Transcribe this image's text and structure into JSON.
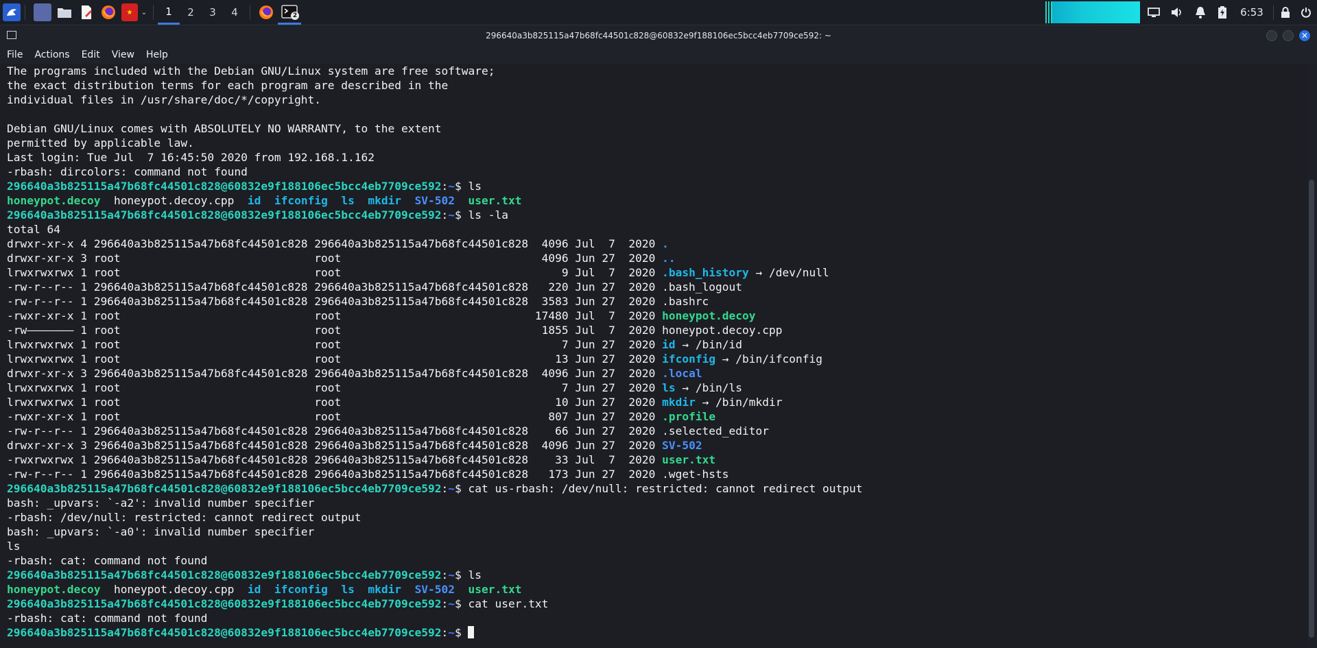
{
  "taskbar": {
    "workspaces": [
      "1",
      "2",
      "3",
      "4"
    ],
    "active_workspace": "1",
    "terminal_badge": "2",
    "clock": "6:53"
  },
  "window": {
    "title": "296640a3b825115a47b68fc44501c828@60832e9f188106ec5bcc4eb7709ce592: ~",
    "close_glyph": "✕"
  },
  "menu": [
    "File",
    "Actions",
    "Edit",
    "View",
    "Help"
  ],
  "terminal": {
    "prompt_user": "296640a3b825115a47b68fc44501c828@60832e9f188106ec5bcc4eb7709ce592",
    "prompt_path": "~",
    "prompt_suffix": "$",
    "lines": [
      {
        "segs": [
          {
            "t": "The programs included with the Debian GNU/Linux system are free software;",
            "c": "plain"
          }
        ]
      },
      {
        "segs": [
          {
            "t": "the exact distribution terms for each program are described in the",
            "c": "plain"
          }
        ]
      },
      {
        "segs": [
          {
            "t": "individual files in /usr/share/doc/*/copyright.",
            "c": "plain"
          }
        ]
      },
      {
        "segs": [
          {
            "t": "",
            "c": "plain"
          }
        ]
      },
      {
        "segs": [
          {
            "t": "Debian GNU/Linux comes with ABSOLUTELY NO WARRANTY, to the extent",
            "c": "plain"
          }
        ]
      },
      {
        "segs": [
          {
            "t": "permitted by applicable law.",
            "c": "plain"
          }
        ]
      },
      {
        "segs": [
          {
            "t": "Last login: Tue Jul  7 16:45:50 2020 from 192.168.1.162",
            "c": "plain"
          }
        ]
      },
      {
        "segs": [
          {
            "t": "-rbash: dircolors: command not found",
            "c": "plain"
          }
        ]
      },
      {
        "prompt": true,
        "segs": [
          {
            "t": " ls",
            "c": "plain"
          }
        ]
      },
      {
        "segs": [
          {
            "t": "honeypot.decoy",
            "c": "exec"
          },
          {
            "t": "  honeypot.decoy.cpp  ",
            "c": "plain"
          },
          {
            "t": "id",
            "c": "linkc"
          },
          {
            "t": "  ",
            "c": "plain"
          },
          {
            "t": "ifconfig",
            "c": "linkc"
          },
          {
            "t": "  ",
            "c": "plain"
          },
          {
            "t": "ls",
            "c": "linkc"
          },
          {
            "t": "  ",
            "c": "plain"
          },
          {
            "t": "mkdir",
            "c": "linkc"
          },
          {
            "t": "  ",
            "c": "plain"
          },
          {
            "t": "SV-502",
            "c": "dirc"
          },
          {
            "t": "  ",
            "c": "plain"
          },
          {
            "t": "user.txt",
            "c": "exec"
          }
        ]
      },
      {
        "prompt": true,
        "segs": [
          {
            "t": " ls -la",
            "c": "plain"
          }
        ]
      },
      {
        "segs": [
          {
            "t": "total 64",
            "c": "plain"
          }
        ]
      },
      {
        "segs": [
          {
            "t": "drwxr-xr-x 4 296640a3b825115a47b68fc44501c828 296640a3b825115a47b68fc44501c828  4096 Jul  7  2020 ",
            "c": "plain"
          },
          {
            "t": ".",
            "c": "dirc"
          }
        ]
      },
      {
        "segs": [
          {
            "t": "drwxr-xr-x 3 root                             root                              4096 Jun 27  2020 ",
            "c": "plain"
          },
          {
            "t": "..",
            "c": "dirc"
          }
        ]
      },
      {
        "segs": [
          {
            "t": "lrwxrwxrwx 1 root                             root                                 9 Jul  7  2020 ",
            "c": "plain"
          },
          {
            "t": ".bash_history",
            "c": "linkc"
          },
          {
            "t": " → /dev/null",
            "c": "plain"
          }
        ]
      },
      {
        "segs": [
          {
            "t": "-rw-r--r-- 1 296640a3b825115a47b68fc44501c828 296640a3b825115a47b68fc44501c828   220 Jun 27  2020 .bash_logout",
            "c": "plain"
          }
        ]
      },
      {
        "segs": [
          {
            "t": "-rw-r--r-- 1 296640a3b825115a47b68fc44501c828 296640a3b825115a47b68fc44501c828  3583 Jun 27  2020 .bashrc",
            "c": "plain"
          }
        ]
      },
      {
        "segs": [
          {
            "t": "-rwxr-xr-x 1 root                             root                             17480 Jul  7  2020 ",
            "c": "plain"
          },
          {
            "t": "honeypot.decoy",
            "c": "exec"
          }
        ]
      },
      {
        "segs": [
          {
            "t": "-rw——————— 1 root                             root                              1855 Jul  7  2020 honeypot.decoy.cpp",
            "c": "plain"
          }
        ]
      },
      {
        "segs": [
          {
            "t": "lrwxrwxrwx 1 root                             root                                 7 Jun 27  2020 ",
            "c": "plain"
          },
          {
            "t": "id",
            "c": "linkc"
          },
          {
            "t": " → /bin/id",
            "c": "plain"
          }
        ]
      },
      {
        "segs": [
          {
            "t": "lrwxrwxrwx 1 root                             root                                13 Jun 27  2020 ",
            "c": "plain"
          },
          {
            "t": "ifconfig",
            "c": "linkc"
          },
          {
            "t": " → /bin/ifconfig",
            "c": "plain"
          }
        ]
      },
      {
        "segs": [
          {
            "t": "drwxr-xr-x 3 296640a3b825115a47b68fc44501c828 296640a3b825115a47b68fc44501c828  4096 Jun 27  2020 ",
            "c": "plain"
          },
          {
            "t": ".local",
            "c": "dirc"
          }
        ]
      },
      {
        "segs": [
          {
            "t": "lrwxrwxrwx 1 root                             root                                 7 Jun 27  2020 ",
            "c": "plain"
          },
          {
            "t": "ls",
            "c": "linkc"
          },
          {
            "t": " → /bin/ls",
            "c": "plain"
          }
        ]
      },
      {
        "segs": [
          {
            "t": "lrwxrwxrwx 1 root                             root                                10 Jun 27  2020 ",
            "c": "plain"
          },
          {
            "t": "mkdir",
            "c": "linkc"
          },
          {
            "t": " → /bin/mkdir",
            "c": "plain"
          }
        ]
      },
      {
        "segs": [
          {
            "t": "-rwxr-xr-x 1 root                             root                               807 Jun 27  2020 ",
            "c": "plain"
          },
          {
            "t": ".profile",
            "c": "exec"
          }
        ]
      },
      {
        "segs": [
          {
            "t": "-rw-r--r-- 1 296640a3b825115a47b68fc44501c828 296640a3b825115a47b68fc44501c828    66 Jun 27  2020 .selected_editor",
            "c": "plain"
          }
        ]
      },
      {
        "segs": [
          {
            "t": "drwxr-xr-x 3 296640a3b825115a47b68fc44501c828 296640a3b825115a47b68fc44501c828  4096 Jun 27  2020 ",
            "c": "plain"
          },
          {
            "t": "SV-502",
            "c": "dirc"
          }
        ]
      },
      {
        "segs": [
          {
            "t": "-rwxrwxrwx 1 296640a3b825115a47b68fc44501c828 296640a3b825115a47b68fc44501c828    33 Jul  7  2020 ",
            "c": "plain"
          },
          {
            "t": "user.txt",
            "c": "exec"
          }
        ]
      },
      {
        "segs": [
          {
            "t": "-rw-r--r-- 1 296640a3b825115a47b68fc44501c828 296640a3b825115a47b68fc44501c828   173 Jun 27  2020 .wget-hsts",
            "c": "plain"
          }
        ]
      },
      {
        "prompt": true,
        "segs": [
          {
            "t": " cat us-rbash: /dev/null: restricted: cannot redirect output",
            "c": "plain"
          }
        ]
      },
      {
        "segs": [
          {
            "t": "bash: _upvars: `-a2': invalid number specifier",
            "c": "plain"
          }
        ]
      },
      {
        "segs": [
          {
            "t": "-rbash: /dev/null: restricted: cannot redirect output",
            "c": "plain"
          }
        ]
      },
      {
        "segs": [
          {
            "t": "bash: _upvars: `-a0': invalid number specifier",
            "c": "plain"
          }
        ]
      },
      {
        "segs": [
          {
            "t": "ls",
            "c": "plain"
          }
        ]
      },
      {
        "segs": [
          {
            "t": "-rbash: cat: command not found",
            "c": "plain"
          }
        ]
      },
      {
        "prompt": true,
        "segs": [
          {
            "t": " ls",
            "c": "plain"
          }
        ]
      },
      {
        "segs": [
          {
            "t": "honeypot.decoy",
            "c": "exec"
          },
          {
            "t": "  honeypot.decoy.cpp  ",
            "c": "plain"
          },
          {
            "t": "id",
            "c": "linkc"
          },
          {
            "t": "  ",
            "c": "plain"
          },
          {
            "t": "ifconfig",
            "c": "linkc"
          },
          {
            "t": "  ",
            "c": "plain"
          },
          {
            "t": "ls",
            "c": "linkc"
          },
          {
            "t": "  ",
            "c": "plain"
          },
          {
            "t": "mkdir",
            "c": "linkc"
          },
          {
            "t": "  ",
            "c": "plain"
          },
          {
            "t": "SV-502",
            "c": "dirc"
          },
          {
            "t": "  ",
            "c": "plain"
          },
          {
            "t": "user.txt",
            "c": "exec"
          }
        ]
      },
      {
        "prompt": true,
        "segs": [
          {
            "t": " cat user.txt",
            "c": "plain"
          }
        ]
      },
      {
        "segs": [
          {
            "t": "-rbash: cat: command not found",
            "c": "plain"
          }
        ]
      },
      {
        "prompt": true,
        "cursor": true,
        "segs": [
          {
            "t": " ",
            "c": "plain"
          }
        ]
      }
    ]
  },
  "colors": {
    "prompt": "#2bd6c0",
    "directory": "#4a90ff",
    "executable": "#34d98e",
    "symlink": "#1fb8e8",
    "accent": "#3d7ae0"
  }
}
